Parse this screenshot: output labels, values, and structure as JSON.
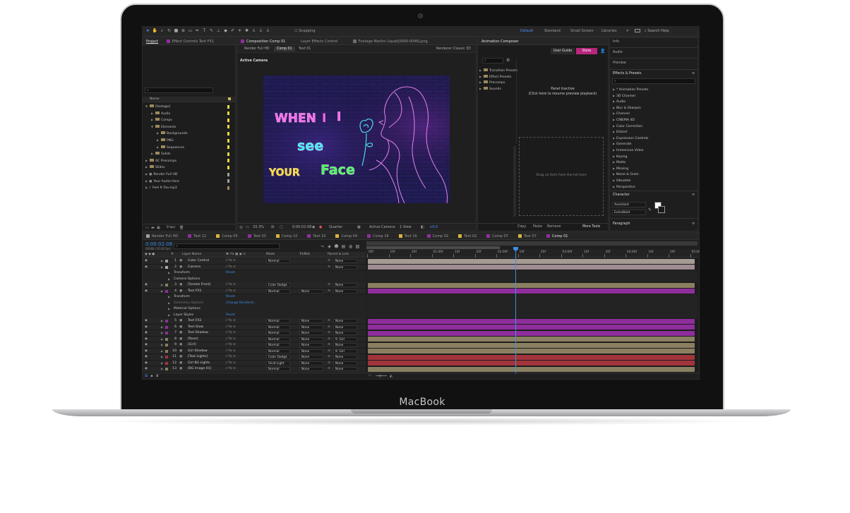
{
  "device": {
    "brand": "MacBook"
  },
  "toolbar": {
    "snapping": "Snapping",
    "workspaces": [
      "Default",
      "Standard",
      "Small Screen",
      "Libraries"
    ],
    "search_placeholder": "Search Help"
  },
  "project": {
    "tabs": [
      "Project",
      "Effect Controls Text FX1"
    ],
    "col_name": "Name",
    "items": [
      {
        "label": "[footage]",
        "level": 0,
        "open": true,
        "type": "folder"
      },
      {
        "label": "Audio",
        "level": 1,
        "open": false,
        "type": "folder"
      },
      {
        "label": "Comps",
        "level": 1,
        "open": false,
        "type": "folder"
      },
      {
        "label": "Elements",
        "level": 1,
        "open": true,
        "type": "folder"
      },
      {
        "label": "Backgrounds",
        "level": 2,
        "open": false,
        "type": "folder"
      },
      {
        "label": "PNG",
        "level": 2,
        "open": false,
        "type": "folder"
      },
      {
        "label": "Sequences",
        "level": 2,
        "open": false,
        "type": "folder"
      },
      {
        "label": "Solids",
        "level": 1,
        "open": false,
        "type": "folder"
      },
      {
        "label": "AC Precomps",
        "level": 0,
        "open": false,
        "type": "folder"
      },
      {
        "label": "Slides",
        "level": 0,
        "open": false,
        "type": "folder"
      },
      {
        "label": "Render Full HD",
        "level": 0,
        "open": false,
        "type": "comp"
      },
      {
        "label": "Your Audio Here",
        "level": 0,
        "open": false,
        "type": "comp"
      },
      {
        "label": "Feel It Too.mp3",
        "level": 0,
        "open": false,
        "type": "audio"
      }
    ],
    "bpc": "8 bpc"
  },
  "composition": {
    "tabs": [
      "Composition Comp 01",
      "Layer Effects Control",
      "Footage Martini Liquid[0000-0046].png"
    ],
    "breadcrumbs": [
      "Render Full HD",
      "Comp 01",
      "Text 01"
    ],
    "renderer_label": "Renderer:",
    "renderer_value": "Classic 3D",
    "view_label": "Active Camera",
    "canvas_text": {
      "when": "WHEN",
      "i": "I",
      "see": "SEE",
      "see2": "see",
      "your": "YOUR",
      "face": "Face"
    },
    "footer": {
      "zoom": "33.3%",
      "time": "0:00:02:08",
      "res": "Quarter",
      "camera": "Active Camera",
      "views": "1 View",
      "offset": "+0.0"
    }
  },
  "animation_composer": {
    "title": "Animation Composer",
    "buttons": [
      "User Guide",
      "Store"
    ],
    "tree": [
      "Transition Presets",
      "Effect Presets",
      "Precomps",
      "Sounds"
    ],
    "inactive_line1": "Panel Inactive",
    "inactive_line2": "(Click here to resume preview playback)",
    "drag_hint": "Drag an item from the list here",
    "footer": [
      "Copy",
      "Paste",
      "Remove",
      "More Tools"
    ]
  },
  "right_panels": {
    "info": "Info",
    "audio": "Audio",
    "preview": "Preview",
    "effects_title": "Effects & Presets",
    "effects": [
      "* Animation Presets",
      "3D Channel",
      "Audio",
      "Blur & Sharpen",
      "Channel",
      "CINEMA 4D",
      "Color Correction",
      "Distort",
      "Expression Controls",
      "Generate",
      "Immersive Video",
      "Keying",
      "Matte",
      "Missing",
      "Noise & Grain",
      "Obsolete",
      "Perspective"
    ],
    "character_title": "Character",
    "font": "Assistant",
    "weight": "ExtraBold",
    "paragraph_title": "Paragraph"
  },
  "timeline": {
    "tabs": [
      "Render Full HD",
      "Text 12",
      "Comp 05",
      "Text 03",
      "Comp 10",
      "Text 10",
      "Comp 04",
      "Comp 16",
      "Text 16",
      "Comp 02",
      "Text 02",
      "Comp 07",
      "Text 07",
      "Comp 01"
    ],
    "active_tab": "Comp 01",
    "timecode": "0:00:02:08",
    "fps": "00068 (30.00 fps)",
    "headers": {
      "layer_name": "Layer Name",
      "mode": "Mode",
      "trkmat": "TrkMat",
      "parent": "Parent & Link"
    },
    "ruler": [
      "00f",
      "10f",
      "20f",
      "01:00f",
      "10f",
      "20f",
      "02:00f",
      "10f",
      "20f",
      "03:00f",
      "10f",
      "20f",
      "04:00f",
      "10f",
      "20f",
      "05:00"
    ],
    "rows": [
      {
        "kind": "layer",
        "num": "1",
        "name": "Color Control",
        "color": "#a49b92",
        "mode": "Normal",
        "trk": "",
        "parent": "None"
      },
      {
        "kind": "layer",
        "num": "2",
        "name": "Camera",
        "color": "#b4a6a6",
        "mode": "",
        "trk": "",
        "parent": "None"
      },
      {
        "kind": "prop",
        "name": "Transform",
        "value": "Reset"
      },
      {
        "kind": "prop",
        "name": "Camera Options",
        "value": ""
      },
      {
        "kind": "layer",
        "num": "3",
        "name": "[Smoke Front]",
        "color": "#8b7f62",
        "mode": "Color Dodge",
        "trk": "",
        "parent": "None"
      },
      {
        "kind": "layer",
        "num": "4",
        "name": "Text FX1",
        "color": "#8e2e9c",
        "mode": "Normal",
        "trk": "None",
        "parent": "None"
      },
      {
        "kind": "prop",
        "name": "Transform",
        "value": "Reset"
      },
      {
        "kind": "prop",
        "name": "Geometry Options",
        "value": "Change Renderer..."
      },
      {
        "kind": "prop",
        "name": "Material Options",
        "value": ""
      },
      {
        "kind": "prop",
        "name": "Layer Styles",
        "value": "Reset"
      },
      {
        "kind": "layer",
        "num": "5",
        "name": "Text FX2",
        "color": "#8e2e9c",
        "mode": "Normal",
        "trk": "None",
        "parent": "None"
      },
      {
        "kind": "layer",
        "num": "6",
        "name": "Text Glow",
        "color": "#8e2e9c",
        "mode": "Normal",
        "trk": "None",
        "parent": "None"
      },
      {
        "kind": "layer",
        "num": "7",
        "name": "Text Shadow",
        "color": "#8e2e9c",
        "mode": "Normal",
        "trk": "None",
        "parent": "None"
      },
      {
        "kind": "layer",
        "num": "8",
        "name": "[Rose]",
        "color": "#8b7f62",
        "mode": "Normal",
        "trk": "None",
        "parent": "9. Girl"
      },
      {
        "kind": "layer",
        "num": "9",
        "name": "[Girl]",
        "color": "#8b7f62",
        "mode": "Normal",
        "trk": "None",
        "parent": "None"
      },
      {
        "kind": "layer",
        "num": "10",
        "name": "Girl Shadow",
        "color": "#8b7f62",
        "mode": "Normal",
        "trk": "None",
        "parent": "9. Girl"
      },
      {
        "kind": "layer",
        "num": "11",
        "name": "[Text Lights]",
        "color": "#a3343b",
        "mode": "Color Dodge",
        "trk": "None",
        "parent": "None"
      },
      {
        "kind": "layer",
        "num": "12",
        "name": "Girl BG Lights",
        "color": "#a3343b",
        "mode": "Vivid Light",
        "trk": "None",
        "parent": "None"
      },
      {
        "kind": "layer",
        "num": "13",
        "name": "[BG Image 01]",
        "color": "#8b7f62",
        "mode": "Normal",
        "trk": "None",
        "parent": "None"
      }
    ]
  }
}
